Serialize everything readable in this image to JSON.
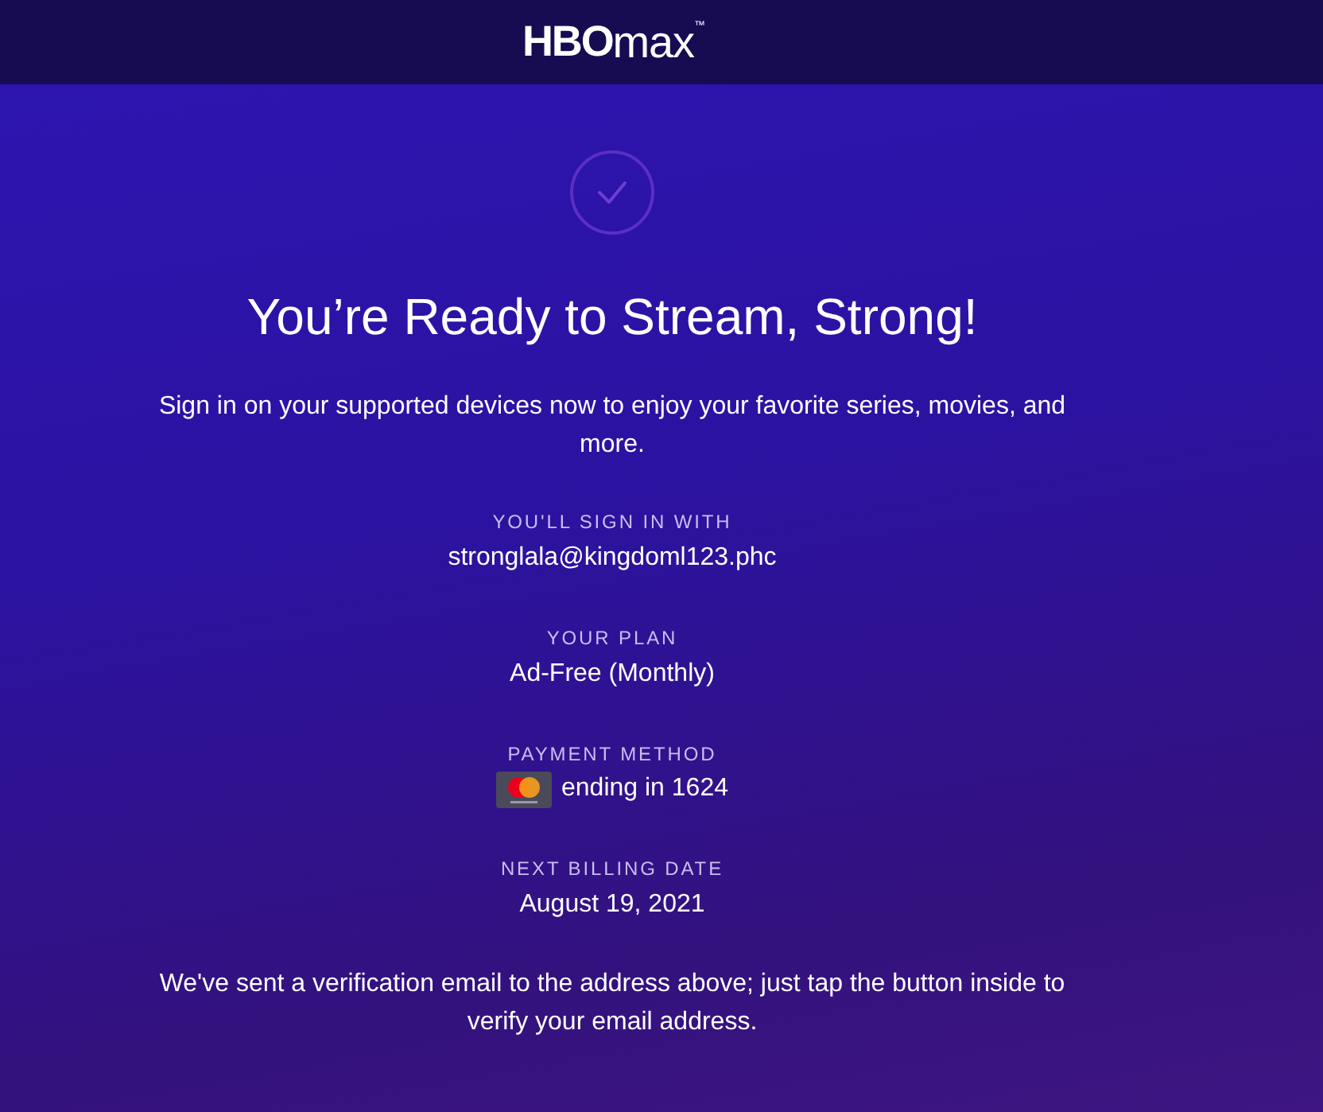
{
  "header": {
    "logo": {
      "brand": "HBO",
      "product": "max",
      "trademark": "™"
    }
  },
  "confirmation": {
    "title": "You’re Ready to Stream, Strong!",
    "message": "Sign in on your supported devices now to enjoy your favorite series, movies, and more."
  },
  "details": [
    {
      "kind": "text",
      "label": "YOU'LL SIGN IN WITH",
      "value": "stronglala@kingdoml123.phc"
    },
    {
      "kind": "text",
      "label": "YOUR PLAN",
      "value": "Ad-Free (Monthly)"
    },
    {
      "kind": "card",
      "label": "PAYMENT METHOD",
      "value": "ending in 1624"
    },
    {
      "kind": "text",
      "label": "NEXT BILLING DATE",
      "value": "August 19, 2021"
    }
  ],
  "footer_note": "We've sent a verification email to the address above; just tap the button inside to verify your email address."
}
